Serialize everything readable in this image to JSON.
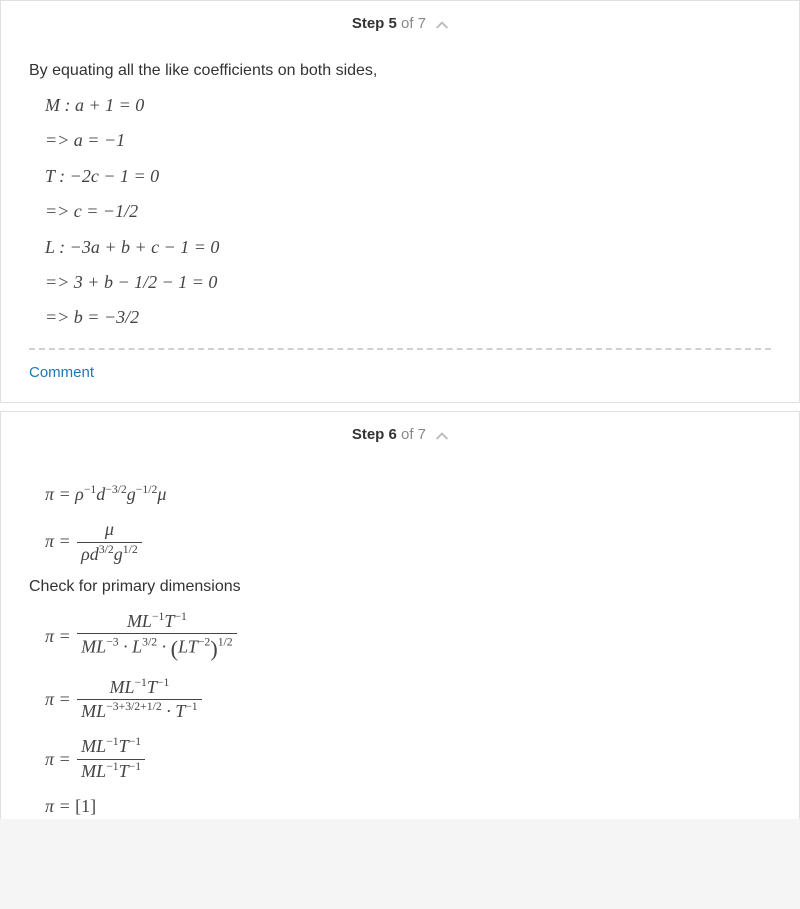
{
  "step5": {
    "label_bold": "Step 5",
    "label_rest": " of 7",
    "intro": "By equating all the like coefficients on both sides,",
    "eq1": "M : a + 1 = 0",
    "eq2": "=> a = −1",
    "eq3": "T : −2c − 1 = 0",
    "eq4": "=> c = −1/2",
    "eq5": "L : −3a + b + c − 1 = 0",
    "eq6": "=> 3 + b − 1/2 − 1 = 0",
    "eq7": "=> b = −3/2",
    "comment": "Comment"
  },
  "step6": {
    "label_bold": "Step 6",
    "label_rest": " of 7",
    "eq1_html": "π = ρ<sup>−1</sup>d<sup>−3/2</sup>g<sup>−1/2</sup>μ",
    "eq2_lhs": "π =",
    "eq2_num": "μ",
    "eq2_den_html": "ρd<sup>3/2</sup>g<sup>1/2</sup>",
    "check_label": "Check for primary dimensions",
    "eq3_lhs": "π =",
    "eq3_num_html": "ML<sup>−1</sup>T<sup>−1</sup>",
    "eq3_den_html": "ML<sup>−3</sup> · L<sup>3/2</sup> · <span class=\"big-paren\">(</span>LT<sup>−2</sup><span class=\"big-paren\">)</span><sup>1/2</sup>",
    "eq4_lhs": "π =",
    "eq4_num_html": "ML<sup>−1</sup>T<sup>−1</sup>",
    "eq4_den_html": "ML<sup>−3+3/2+1/2</sup> · T<sup>−1</sup>",
    "eq5_lhs": "π =",
    "eq5_num_html": "ML<sup>−1</sup>T<sup>−1</sup>",
    "eq5_den_html": "ML<sup>−1</sup>T<sup>−1</sup>",
    "eq6_html": "π = <span class=\"rm\">[1]</span>"
  }
}
